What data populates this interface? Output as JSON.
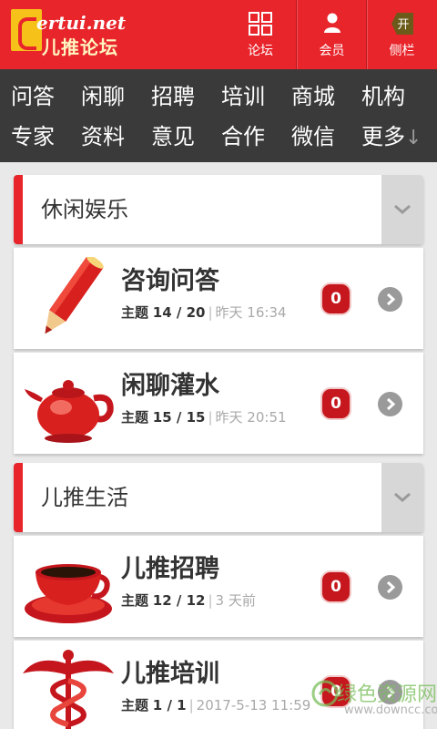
{
  "header": {
    "logo_en": "ertui.net",
    "logo_cn": "儿推论坛",
    "buttons": [
      {
        "label": "论坛",
        "icon": "grid-icon"
      },
      {
        "label": "会员",
        "icon": "user-icon"
      },
      {
        "label": "侧栏",
        "icon": "open-sidebar-icon",
        "icon_text": "开"
      }
    ]
  },
  "categories": {
    "row1": [
      "问答",
      "闲聊",
      "招聘",
      "培训",
      "商城",
      "机构"
    ],
    "row2": [
      "专家",
      "资料",
      "意见",
      "合作",
      "微信",
      "更多"
    ],
    "more_arrow": "↓"
  },
  "sections": [
    {
      "title": "休闲娱乐",
      "forums": [
        {
          "name": "咨询问答",
          "topics_label": "主题",
          "topics": "14 / 20",
          "last_post": "昨天 16:34",
          "new_count": "0",
          "icon": "pencil-icon"
        },
        {
          "name": "闲聊灌水",
          "topics_label": "主题",
          "topics": "15 / 15",
          "last_post": "昨天 20:51",
          "new_count": "0",
          "icon": "teapot-icon"
        }
      ]
    },
    {
      "title": "儿推生活",
      "forums": [
        {
          "name": "儿推招聘",
          "topics_label": "主题",
          "topics": "12 / 12",
          "last_post": "3 天前",
          "new_count": "0",
          "icon": "coffee-cup-icon"
        },
        {
          "name": "儿推培训",
          "topics_label": "主题",
          "topics": "1 / 1",
          "last_post": "2017-5-13 11:59",
          "new_count": "0",
          "icon": "caduceus-icon"
        }
      ]
    }
  ],
  "watermark": {
    "cn": "绿色资源网",
    "url": "www.downcc.com"
  },
  "colors": {
    "brand_red": "#e8252b",
    "nav_dark": "#3a3a3a",
    "badge_red": "#c5171d",
    "logo_yellow": "#f6c21a"
  }
}
